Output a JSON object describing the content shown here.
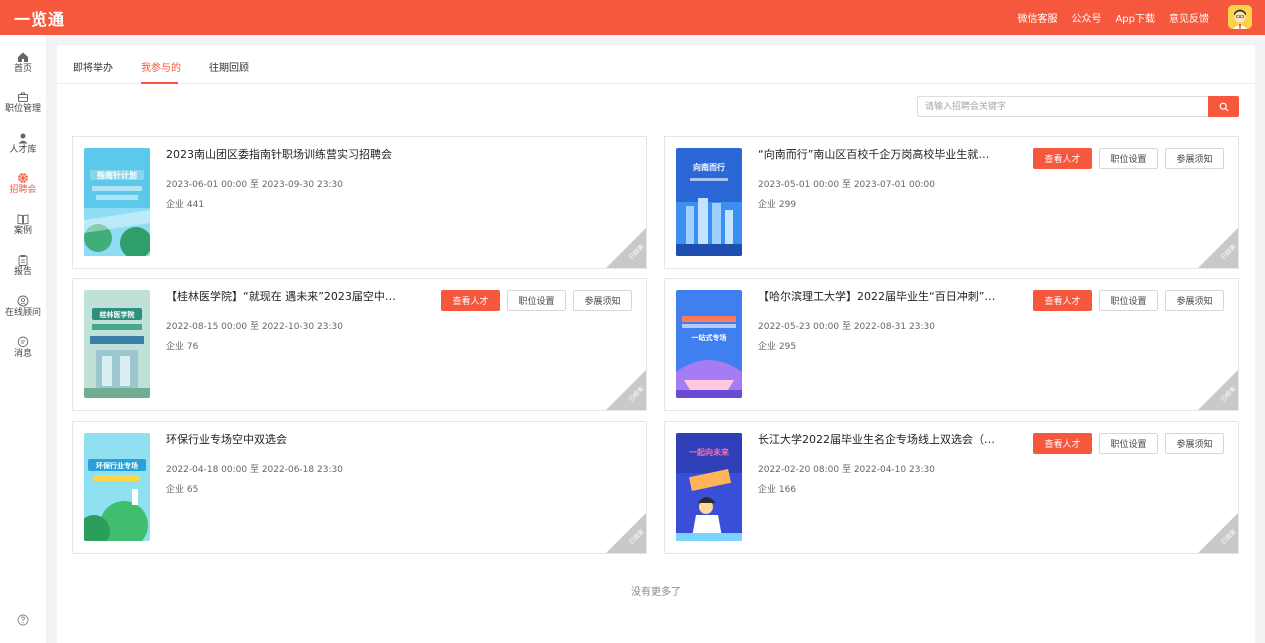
{
  "app": {
    "logo": "一览通"
  },
  "topnav": {
    "wechat_service": "微信客服",
    "official_account": "公众号",
    "app_download": "App下载",
    "feedback": "意见反馈"
  },
  "sidebar": {
    "home": "首页",
    "jobs": "职位管理",
    "talent": "人才库",
    "fair": "招聘会",
    "cases": "案例",
    "reports": "报告",
    "consult": "在线顾问",
    "messages": "消息"
  },
  "tabs": {
    "upcoming": "即将举办",
    "joined": "我参与的",
    "past": "往期回顾"
  },
  "search": {
    "placeholder": "请输入招聘会关键字"
  },
  "buttons": {
    "view_talent": "查看人才",
    "job_settings": "职位设置",
    "notice": "参展须知"
  },
  "badge": {
    "ended": "已结束"
  },
  "cards": [
    {
      "title": "2023南山团区委指南针职场训练营实习招聘会",
      "date": "2023-06-01 00:00 至 2023-09-30 23:30",
      "companies": "企业 441",
      "poster_text": "指南针计划"
    },
    {
      "title": "“向南而行”南山区百校千企万岗高校毕业生就业…",
      "date": "2023-05-01 00:00 至 2023-07-01 00:00",
      "companies": "企业 299",
      "poster_text": "向南而行"
    },
    {
      "title": "【桂林医学院】“就现在 遇未来”2023届空中双…",
      "date": "2022-08-15 00:00 至 2022-10-30 23:30",
      "companies": "企业 76",
      "poster_text": "桂林医学院"
    },
    {
      "title": "【哈尔滨理工大学】2022届毕业生“百日冲刺”…",
      "date": "2022-05-23 00:00 至 2022-08-31 23:30",
      "companies": "企业 295",
      "poster_text": "一站式专场"
    },
    {
      "title": "环保行业专场空中双选会",
      "date": "2022-04-18 00:00 至 2022-06-18 23:30",
      "companies": "企业 65",
      "poster_text": "环保行业专场"
    },
    {
      "title": "长江大学2022届毕业生名企专场线上双选会（…",
      "date": "2022-02-20 08:00 至 2022-04-10 23:30",
      "companies": "企业 166",
      "poster_text": "一起向未来"
    }
  ],
  "footer": {
    "no_more": "没有更多了"
  },
  "colors": {
    "brand": "#f5583c",
    "page_bg": "#f2f3f5"
  }
}
